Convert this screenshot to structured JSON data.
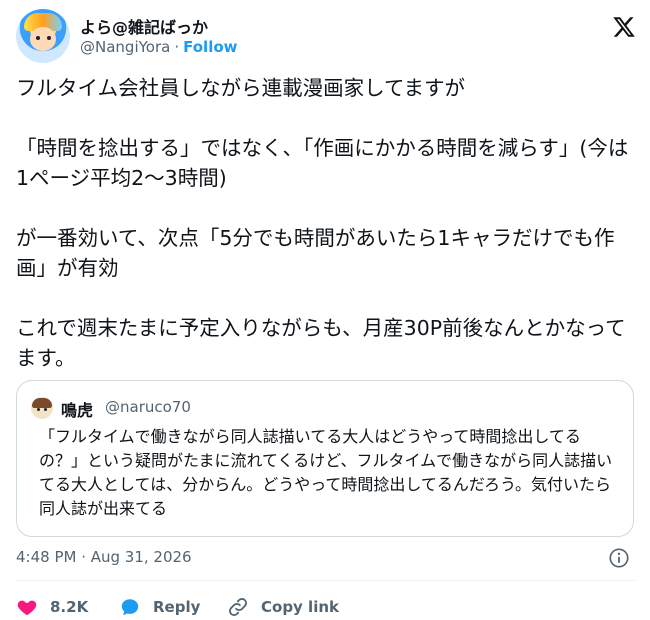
{
  "author": {
    "name": "よら@雑記ばっか",
    "handle": "@NangiYora",
    "separator": "·",
    "follow_label": "Follow"
  },
  "tweet": {
    "paragraphs": [
      "フルタイム会社員しながら連載漫画家してますが",
      "「時間を捻出する」ではなく、「作画にかかる時間を減らす」(今は1ページ平均2〜3時間)",
      "が一番効いて、次点「5分でも時間があいたら1キャラだけでも作画」が有効",
      "これで週末たまに予定入りながらも、月産30P前後なんとかなってます。"
    ]
  },
  "quote": {
    "name": "鳴虎",
    "handle": "@naruco70",
    "text": "「フルタイムで働きながら同人誌描いてる大人はどうやって時間捻出してるの？」という疑問がたまに流れてくるけど、フルタイムで働きながら同人誌描いてる大人としては、分からん。どうやって時間捻出してるんだろう。気付いたら同人誌が出来てる"
  },
  "meta": {
    "timestamp": "4:48 PM · Aug 31, 2026"
  },
  "actions": {
    "like_count": "8.2K",
    "reply_label": "Reply",
    "copy_label": "Copy link"
  },
  "icons": {
    "like": "heart-icon",
    "reply": "reply-bubble-icon",
    "copy": "link-icon",
    "info": "info-icon",
    "brand": "x-logo-icon"
  },
  "colors": {
    "like": "#f91880",
    "reply": "#1d9bf0",
    "link": "#1d9bf0",
    "text": "#0f1419",
    "muted": "#536471"
  }
}
